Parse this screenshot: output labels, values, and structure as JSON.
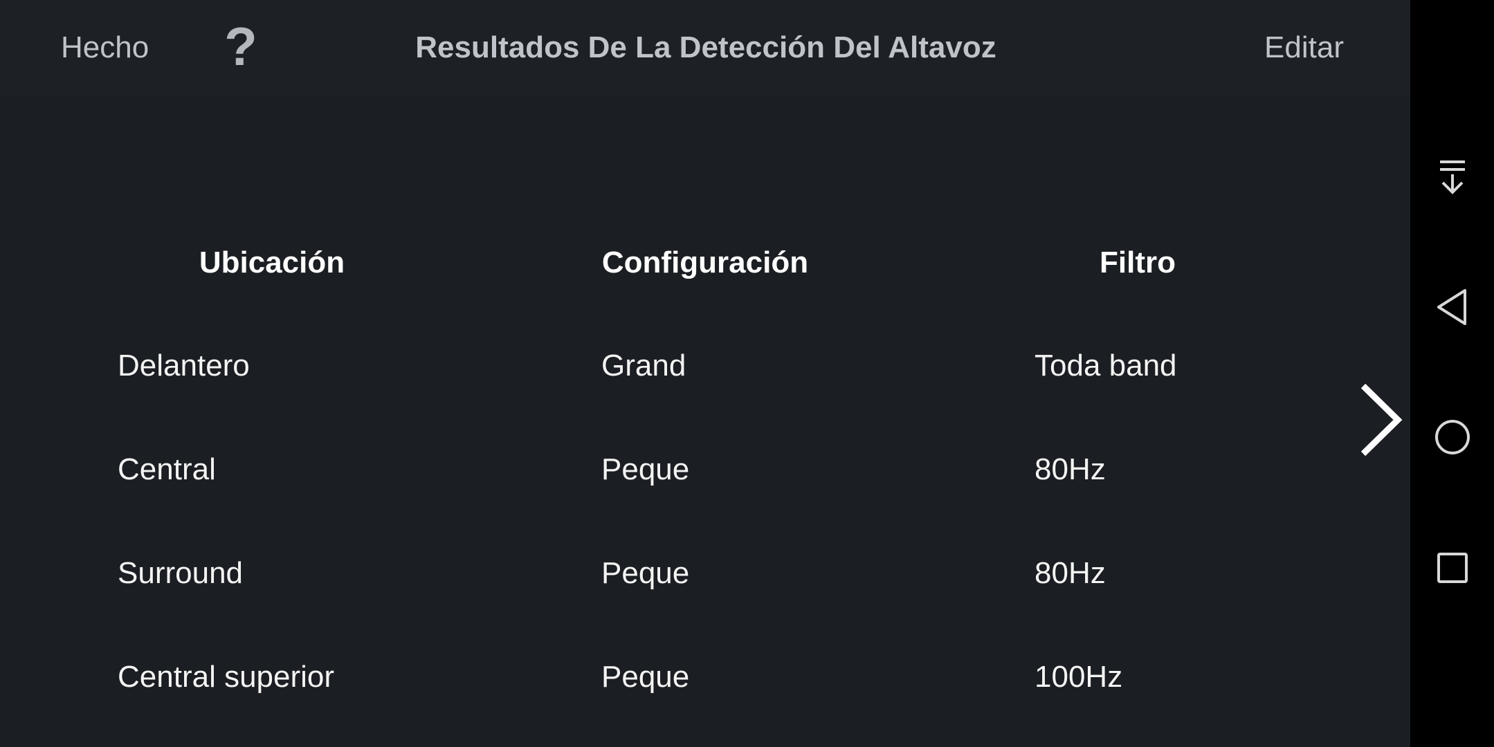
{
  "header": {
    "done_label": "Hecho",
    "help_label": "?",
    "title": "Resultados De La Detección Del Altavoz",
    "edit_label": "Editar"
  },
  "table": {
    "columns": [
      "Ubicación",
      "Configuración",
      "Filtro"
    ],
    "rows": [
      [
        "Delantero",
        "Grand",
        "Toda band"
      ],
      [
        "Central",
        "Peque",
        "80Hz"
      ],
      [
        "Surround",
        "Peque",
        "80Hz"
      ],
      [
        "Central superior",
        "Peque",
        "100Hz"
      ]
    ]
  },
  "icons": {
    "next": "chevron-right-icon",
    "nav_collapse": "collapse-down-icon",
    "nav_back": "back-triangle-icon",
    "nav_home": "home-circle-icon",
    "nav_recents": "recents-square-icon"
  }
}
